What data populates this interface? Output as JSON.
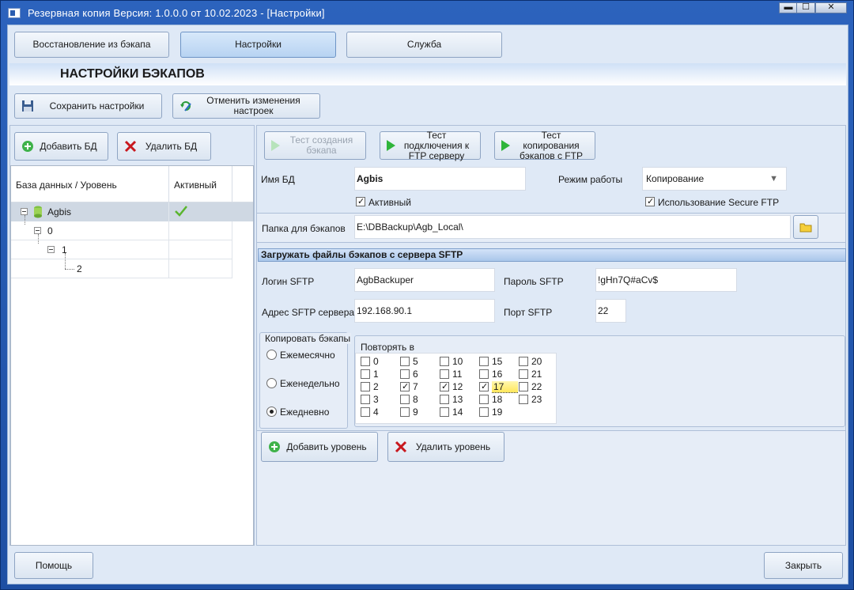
{
  "window": {
    "title": "Резервная копия   Версия: 1.0.0.0 от 10.02.2023 - [Настройки]",
    "minimize": "▬",
    "maximize": "☐",
    "close": "✕"
  },
  "tabs": [
    {
      "label": "Восстановление из бэкапа",
      "active": false
    },
    {
      "label": "Настройки",
      "active": true
    },
    {
      "label": "Служба",
      "active": false
    }
  ],
  "header": {
    "title": "НАСТРОЙКИ БЭКАПОВ"
  },
  "toolbar": {
    "save_label": "Сохранить настройки",
    "cancel_label": "Отменить изменения настроек"
  },
  "db_actions": {
    "add_label": "Добавить БД",
    "delete_label": "Удалить БД"
  },
  "tree": {
    "col_db": "База данных / Уровень",
    "col_active": "Активный",
    "root": {
      "label": "Agbis",
      "active": true
    },
    "level0": "0",
    "level1": "1",
    "level2": "2"
  },
  "tests": {
    "create": "Тест создания бэкапа",
    "ftp_connect": "Тест подключения к FTP серверу",
    "ftp_copy": "Тест копирования бэкапов с FTP"
  },
  "form": {
    "db_name_label": "Имя БД",
    "db_name_value": "Agbis",
    "mode_label": "Режим работы",
    "mode_value": "Копирование",
    "active_label": "Активный",
    "active_checked": true,
    "sftp_label": "Использование Secure FTP",
    "sftp_checked": true,
    "folder_label": "Папка для бэкапов",
    "folder_value": "E:\\DBBackup\\Agb_Local\\"
  },
  "sftp": {
    "header": "Загружать файлы бэкапов с сервера SFTP",
    "login_label": "Логин SFTP",
    "login_value": "AgbBackuper",
    "password_label": "Пароль SFTP",
    "password_value": "!gHn7Q#aCv$",
    "address_label": "Адрес SFTP сервера",
    "address_value": "192.168.90.1",
    "port_label": "Порт SFTP",
    "port_value": "22"
  },
  "copy": {
    "group_label": "Копировать бэкапы",
    "monthly": "Ежемесячно",
    "weekly": "Еженедельно",
    "daily": "Ежедневно",
    "selected": "daily"
  },
  "repeat": {
    "label": "Повторять в",
    "hours": [
      {
        "h": "0",
        "checked": false
      },
      {
        "h": "1",
        "checked": false
      },
      {
        "h": "2",
        "checked": false
      },
      {
        "h": "3",
        "checked": false
      },
      {
        "h": "4",
        "checked": false
      },
      {
        "h": "5",
        "checked": false
      },
      {
        "h": "6",
        "checked": false
      },
      {
        "h": "7",
        "checked": true
      },
      {
        "h": "8",
        "checked": false
      },
      {
        "h": "9",
        "checked": false
      },
      {
        "h": "10",
        "checked": false
      },
      {
        "h": "11",
        "checked": false
      },
      {
        "h": "12",
        "checked": true
      },
      {
        "h": "13",
        "checked": false
      },
      {
        "h": "14",
        "checked": false
      },
      {
        "h": "15",
        "checked": false
      },
      {
        "h": "16",
        "checked": false
      },
      {
        "h": "17",
        "checked": true
      },
      {
        "h": "18",
        "checked": false
      },
      {
        "h": "19",
        "checked": false
      },
      {
        "h": "20",
        "checked": false
      },
      {
        "h": "21",
        "checked": false
      },
      {
        "h": "22",
        "checked": false
      },
      {
        "h": "23",
        "checked": false
      }
    ]
  },
  "level_actions": {
    "add_label": "Добавить уровень",
    "delete_label": "Удалить уровень"
  },
  "footer": {
    "help_label": "Помощь",
    "close_label": "Закрыть"
  }
}
